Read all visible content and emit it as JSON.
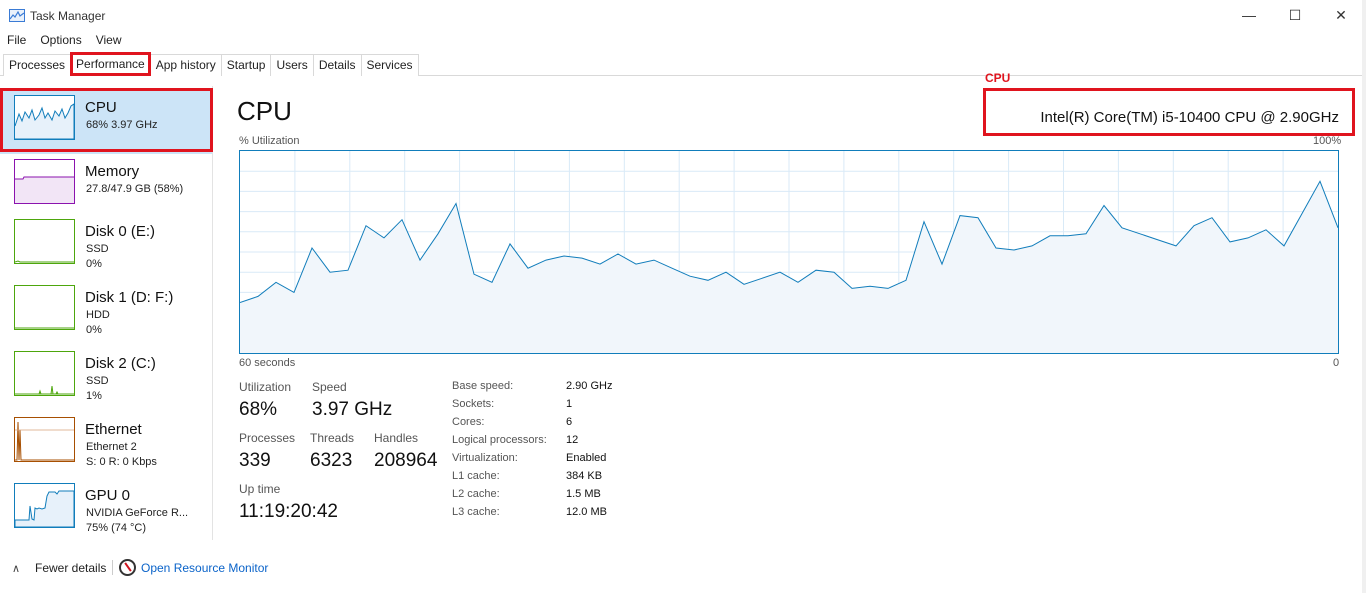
{
  "window": {
    "title": "Task Manager",
    "controls": {
      "minimize": "—",
      "maximize": "☐",
      "close": "✕"
    }
  },
  "menu": [
    "File",
    "Options",
    "View"
  ],
  "tabs": [
    {
      "label": "Processes"
    },
    {
      "label": "Performance"
    },
    {
      "label": "App history"
    },
    {
      "label": "Startup"
    },
    {
      "label": "Users"
    },
    {
      "label": "Details"
    },
    {
      "label": "Services"
    }
  ],
  "active_tab": "Performance",
  "sidebar": {
    "items": [
      {
        "name": "CPU",
        "line1": "68%  3.97 GHz",
        "line2": "",
        "color": "#117dbb",
        "icon": "cpu-graph-icon"
      },
      {
        "name": "Memory",
        "line1": "27.8/47.9 GB (58%)",
        "line2": "",
        "color": "#8b12ae",
        "icon": "memory-graph-icon"
      },
      {
        "name": "Disk 0 (E:)",
        "line1": "SSD",
        "line2": "0%",
        "color": "#4da60c",
        "icon": "disk-graph-icon"
      },
      {
        "name": "Disk 1 (D: F:)",
        "line1": "HDD",
        "line2": "0%",
        "color": "#4da60c",
        "icon": "disk-graph-icon"
      },
      {
        "name": "Disk 2 (C:)",
        "line1": "SSD",
        "line2": "1%",
        "color": "#4da60c",
        "icon": "disk-graph-icon"
      },
      {
        "name": "Ethernet",
        "line1": "Ethernet 2",
        "line2": "S: 0  R: 0 Kbps",
        "color": "#a74f01",
        "icon": "ethernet-graph-icon"
      },
      {
        "name": "GPU 0",
        "line1": "NVIDIA GeForce R...",
        "line2": "75%  (74 °C)",
        "color": "#117dbb",
        "icon": "gpu-graph-icon"
      }
    ]
  },
  "annotation": {
    "red_label": "CPU"
  },
  "main": {
    "title": "CPU",
    "cpu_name": "Intel(R) Core(TM) i5-10400 CPU @ 2.90GHz",
    "graph_label": "% Utilization",
    "graph_max": "100%",
    "time_span": "60 seconds",
    "time_zero": "0",
    "stats": {
      "utilization_label": "Utilization",
      "utilization": "68%",
      "speed_label": "Speed",
      "speed": "3.97 GHz",
      "processes_label": "Processes",
      "processes": "339",
      "threads_label": "Threads",
      "threads": "6323",
      "handles_label": "Handles",
      "handles": "208964",
      "uptime_label": "Up time",
      "uptime": "11:19:20:42"
    },
    "specs": [
      {
        "label": "Base speed:",
        "value": "2.90 GHz"
      },
      {
        "label": "Sockets:",
        "value": "1"
      },
      {
        "label": "Cores:",
        "value": "6"
      },
      {
        "label": "Logical processors:",
        "value": "12"
      },
      {
        "label": "Virtualization:",
        "value": "Enabled"
      },
      {
        "label": "L1 cache:",
        "value": "384 KB"
      },
      {
        "label": "L2 cache:",
        "value": "1.5 MB"
      },
      {
        "label": "L3 cache:",
        "value": "12.0 MB"
      }
    ],
    "utilization_history": [
      25,
      28,
      35,
      30,
      52,
      40,
      41,
      63,
      57,
      66,
      46,
      59,
      74,
      39,
      35,
      54,
      42,
      46,
      48,
      47,
      44,
      49,
      44,
      46,
      42,
      38,
      36,
      40,
      34,
      37,
      40,
      35,
      41,
      40,
      32,
      33,
      32,
      36,
      65,
      44,
      68,
      67,
      52,
      51,
      53,
      58,
      58,
      59,
      73,
      62,
      59,
      56,
      53,
      63,
      67,
      55,
      57,
      61,
      53,
      69,
      85,
      62
    ]
  },
  "footer": {
    "fewer_details": "Fewer details",
    "open_resource_monitor": "Open Resource Monitor"
  }
}
